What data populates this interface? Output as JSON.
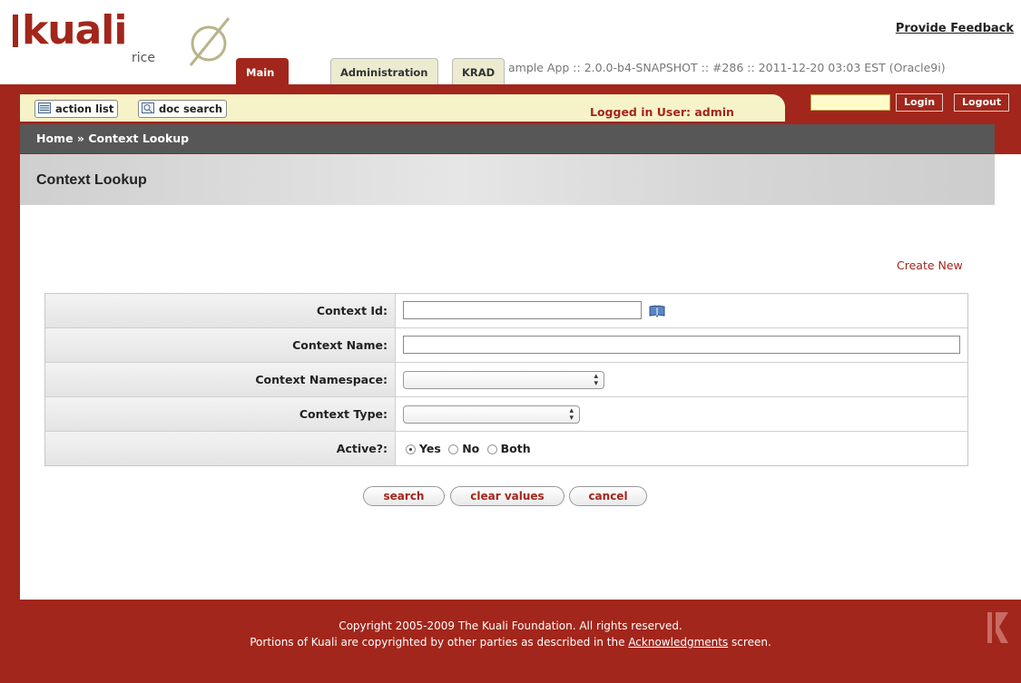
{
  "logo": {
    "wordmark": "kuali",
    "product": "rice"
  },
  "header": {
    "feedback_label": "Provide Feedback",
    "tabs": [
      {
        "label": "Main Menu",
        "active": true
      },
      {
        "label": "Administration",
        "active": false
      },
      {
        "label": "KRAD",
        "active": false
      }
    ],
    "version_text": "ample App :: 2.0.0-b4-SNAPSHOT :: #286 :: 2011-12-20 03:03 EST (Oracle9i)"
  },
  "nav": {
    "action_list_label": "action list",
    "doc_search_label": "doc search",
    "logged_in_text": "Logged in User: admin",
    "login_value": "",
    "login_label": "Login",
    "logout_label": "Logout"
  },
  "breadcrumb": {
    "text": "Home » Context Lookup"
  },
  "page": {
    "title": "Context Lookup",
    "create_new_label": "Create New"
  },
  "form": {
    "fields": [
      {
        "label": "Context Id:",
        "value": ""
      },
      {
        "label": "Context Name:",
        "value": ""
      },
      {
        "label": "Context Namespace:",
        "value": ""
      },
      {
        "label": "Context Type:",
        "value": ""
      },
      {
        "label": "Active?:"
      }
    ],
    "active_options": [
      {
        "label": "Yes",
        "selected": true
      },
      {
        "label": "No",
        "selected": false
      },
      {
        "label": "Both",
        "selected": false
      }
    ]
  },
  "buttons": {
    "search": "search",
    "clear": "clear values",
    "cancel": "cancel"
  },
  "footer": {
    "line1": "Copyright 2005-2009 The Kuali Foundation. All rights reserved.",
    "line2_prefix": "Portions of Kuali are copyrighted by other parties as described in the",
    "line2_link": "Acknowledgments",
    "line2_suffix": "screen."
  },
  "colors": {
    "brand_red": "#a2261b",
    "nav_yellow": "#f7f3c8",
    "breadcrumb_gray": "#575757"
  }
}
